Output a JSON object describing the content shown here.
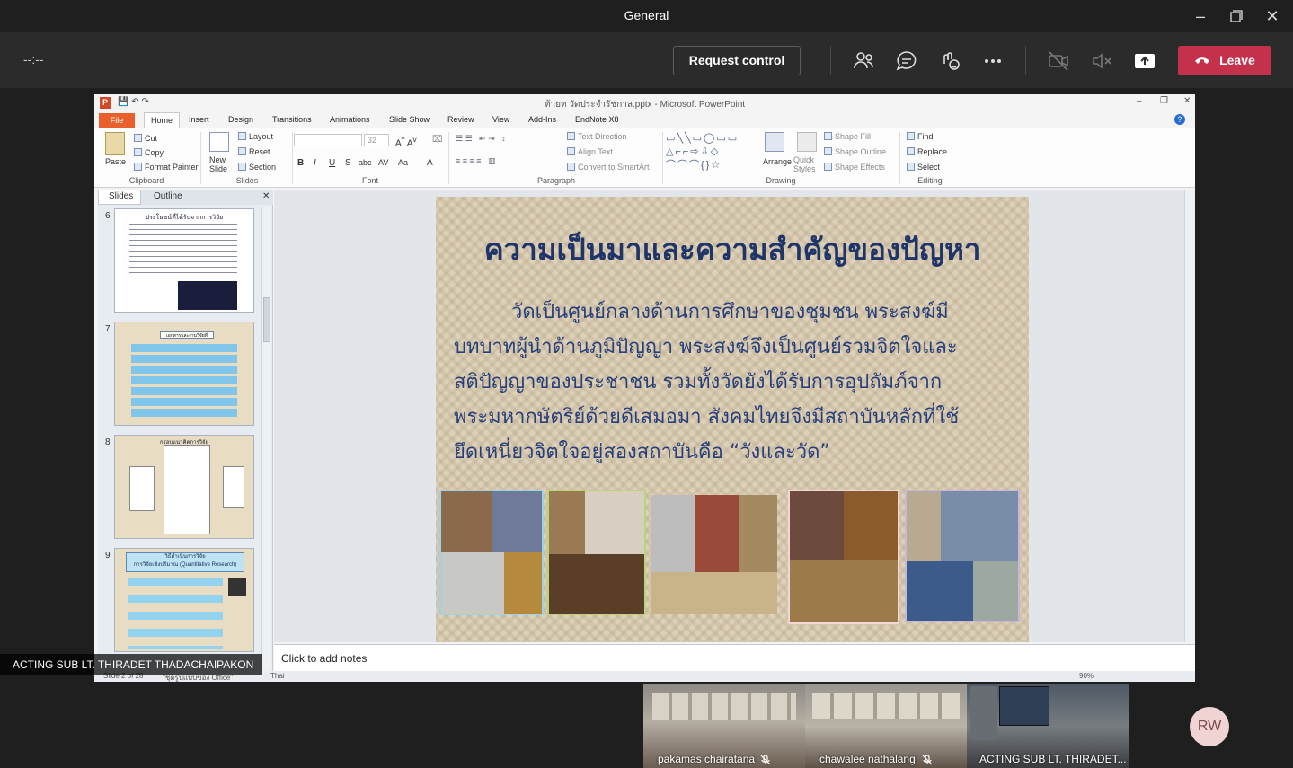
{
  "window": {
    "title": "General"
  },
  "meeting": {
    "timer": "--:--",
    "request_control": "Request control",
    "leave": "Leave"
  },
  "icons": [
    "participants-icon",
    "chat-icon",
    "reactions-icon",
    "more-icon",
    "camera-off-icon",
    "mic-muted-icon",
    "share-tray-icon",
    "phone-hangup-icon"
  ],
  "powerpoint": {
    "title": "ท้ายท วัดประจำรัชกาล.pptx - Microsoft PowerPoint",
    "tabs": [
      "File",
      "Home",
      "Insert",
      "Design",
      "Transitions",
      "Animations",
      "Slide Show",
      "Review",
      "View",
      "Add-Ins",
      "EndNote X8"
    ],
    "ribbon": {
      "clipboard": {
        "paste": "Paste",
        "cut": "Cut",
        "copy": "Copy",
        "format_painter": "Format Painter",
        "label": "Clipboard"
      },
      "slides": {
        "new_slide": "New Slide",
        "layout": "Layout",
        "reset": "Reset",
        "section": "Section",
        "label": "Slides"
      },
      "font": {
        "size": "32",
        "label": "Font",
        "bold": "B",
        "italic": "I",
        "underline": "U",
        "strike": "S",
        "abc": "abc",
        "av": "AV",
        "aa": "Aa",
        "a": "A"
      },
      "paragraph": {
        "text_direction": "Text Direction",
        "align_text": "Align Text",
        "smartart": "Convert to SmartArt",
        "label": "Paragraph"
      },
      "drawing": {
        "shape_fill": "Shape Fill",
        "shape_outline": "Shape Outline",
        "shape_effects": "Shape Effects",
        "arrange": "Arrange",
        "quick_styles": "Quick Styles",
        "label": "Drawing"
      },
      "editing": {
        "find": "Find",
        "replace": "Replace",
        "select": "Select",
        "label": "Editing"
      }
    },
    "pane_tabs": {
      "slides": "Slides",
      "outline": "Outline"
    },
    "thumbnails": [
      {
        "num": "6",
        "title": "ประโยชน์ที่ได้รับจากการวิจัย"
      },
      {
        "num": "7",
        "title": "เอกสารและงานวิจัยที่เกี่ยวข้อง"
      },
      {
        "num": "8",
        "title": "กรอบแนวคิดการวิจัย"
      },
      {
        "num": "9",
        "title": "วิธีดำเนินการวิจัย",
        "subtitle": "การวิจัยเชิงปริมาณ (Quantitative Research)"
      }
    ],
    "slide": {
      "title": "ความเป็นมาและความสำคัญของปัญหา",
      "lines": [
        "วัดเป็นศูนย์กลางด้านการศึกษาของชุมชน พระสงฆ์มี",
        "บทบาทผู้นำด้านภูมิปัญญา พระสงฆ์จึงเป็นศูนย์รวมจิตใจและ",
        "สติปัญญาของประชาชน รวมทั้งวัดยังได้รับการอุปถัมภ์จาก",
        "พระมหากษัตริย์ด้วยดีเสมอมา สังคมไทยจึงมีสถาบันหลักที่ใช้",
        "ยึดเหนี่ยวจิตใจอยู่สองสถาบันคือ “วังและวัด”"
      ]
    },
    "notes_placeholder": "Click to add notes",
    "status": {
      "slide": "Slide 2 of 28",
      "theme": "\"ชุดรูปแบบของ Office\"",
      "lang": "Thai",
      "zoom": "90%"
    }
  },
  "presenter_label": "ACTING SUB LT. THIRADET THADACHAIPAKON",
  "participants": [
    {
      "name": "pakamas chairatana"
    },
    {
      "name": "chawalee nathalang"
    },
    {
      "name": "ACTING SUB LT. THIRADET..."
    }
  ],
  "avatar": "RW"
}
